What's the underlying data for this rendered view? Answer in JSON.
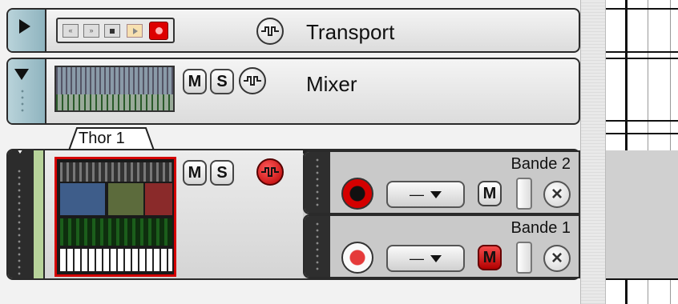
{
  "colors": {
    "accent_red": "#d40000",
    "handle_blue": "#9dbfc9",
    "lane_gray": "#c9c9c9",
    "thor_stripe": "#b7d39a"
  },
  "tracks": {
    "transport": {
      "name": "Transport",
      "transport_icons": [
        "rewind-icon",
        "fast-forward-icon",
        "stop-icon",
        "play-icon",
        "record-icon"
      ],
      "wave_icon": "waveform-icon"
    },
    "mixer": {
      "name": "Mixer",
      "mute_label": "M",
      "solo_label": "S",
      "wave_icon": "waveform-icon"
    },
    "thor": {
      "tab_label": "Thor 1",
      "mute_label": "M",
      "solo_label": "S",
      "wave_icon": "waveform-icon",
      "lanes": [
        {
          "name": "Bande 2",
          "dropdown_value": "—",
          "mute_label": "M",
          "remove_icon": "close-icon",
          "record_armed": true
        },
        {
          "name": "Bande 1",
          "dropdown_value": "—",
          "mute_label": "M",
          "remove_icon": "close-icon",
          "record_armed": false
        }
      ]
    }
  }
}
